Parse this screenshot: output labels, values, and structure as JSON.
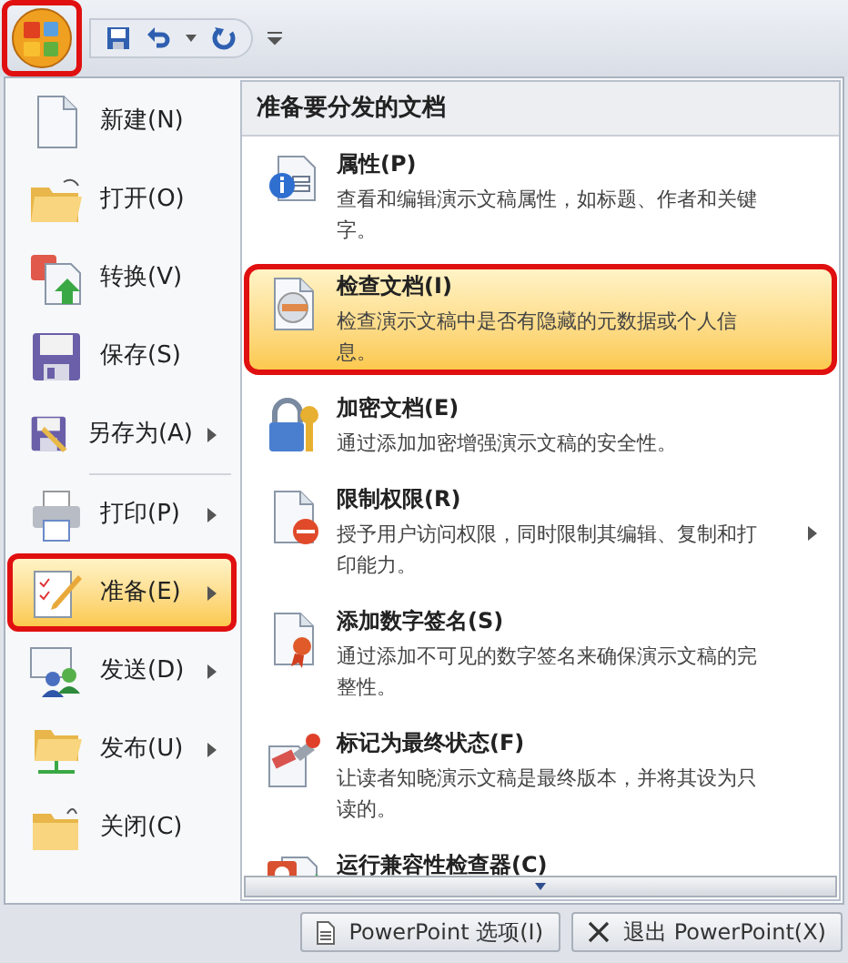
{
  "left_menu": [
    {
      "label": "新建(N)",
      "has_submenu": false,
      "selected": false
    },
    {
      "label": "打开(O)",
      "has_submenu": false,
      "selected": false
    },
    {
      "label": "转换(V)",
      "has_submenu": false,
      "selected": false
    },
    {
      "label": "保存(S)",
      "has_submenu": false,
      "selected": false
    },
    {
      "label": "另存为(A)",
      "has_submenu": true,
      "selected": false
    },
    {
      "label": "打印(P)",
      "has_submenu": true,
      "selected": false
    },
    {
      "label": "准备(E)",
      "has_submenu": true,
      "selected": true
    },
    {
      "label": "发送(D)",
      "has_submenu": true,
      "selected": false
    },
    {
      "label": "发布(U)",
      "has_submenu": true,
      "selected": false
    },
    {
      "label": "关闭(C)",
      "has_submenu": false,
      "selected": false
    }
  ],
  "submenu": {
    "title": "准备要分发的文档",
    "items": [
      {
        "label": "属性(P)",
        "description": "查看和编辑演示文稿属性，如标题、作者和关键字。",
        "has_submenu": false,
        "selected": false
      },
      {
        "label": "检查文档(I)",
        "description": "检查演示文稿中是否有隐藏的元数据或个人信息。",
        "has_submenu": false,
        "selected": true
      },
      {
        "label": "加密文档(E)",
        "description": "通过添加加密增强演示文稿的安全性。",
        "has_submenu": false,
        "selected": false
      },
      {
        "label": "限制权限(R)",
        "description": "授予用户访问权限，同时限制其编辑、复制和打印能力。",
        "has_submenu": true,
        "selected": false
      },
      {
        "label": "添加数字签名(S)",
        "description": "通过添加不可见的数字签名来确保演示文稿的完整性。",
        "has_submenu": false,
        "selected": false
      },
      {
        "label": "标记为最终状态(F)",
        "description": "让读者知晓演示文稿是最终版本，并将其设为只读的。",
        "has_submenu": false,
        "selected": false
      },
      {
        "label": "运行兼容性检查器(C)",
        "has_submenu": false,
        "selected": false
      }
    ]
  },
  "bottom_buttons": [
    "PowerPoint 选项(I)",
    "退出 PowerPoint(X)"
  ]
}
